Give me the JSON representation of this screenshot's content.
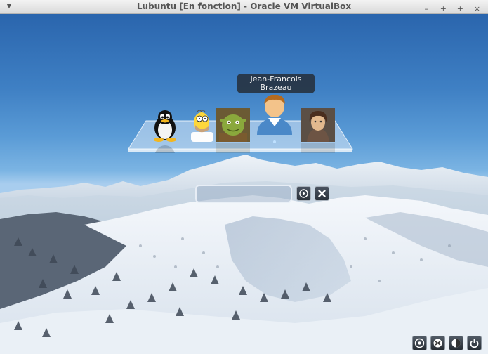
{
  "window": {
    "title": "Lubuntu [En fonction] - Oracle VM VirtualBox",
    "menu_icon": "chevron-down-icon",
    "controls": [
      {
        "name": "minimize-button",
        "glyph": "–"
      },
      {
        "name": "maximize-button",
        "glyph": "+"
      },
      {
        "name": "restore-button",
        "glyph": "+"
      },
      {
        "name": "close-button",
        "glyph": "×"
      }
    ]
  },
  "login": {
    "users": [
      {
        "id": "tux",
        "avatar": "tux-penguin-avatar"
      },
      {
        "id": "homer",
        "avatar": "homer-avatar"
      },
      {
        "id": "shrek",
        "avatar": "shrek-avatar"
      },
      {
        "id": "jean-francois",
        "avatar": "generic-user-avatar",
        "selected": true
      },
      {
        "id": "photo",
        "avatar": "photo-avatar"
      }
    ],
    "selected_user_name": "Jean-Francois Brazeau",
    "password_value": "",
    "submit_icon": "play-icon",
    "cancel_icon": "close-icon"
  },
  "bottom_buttons": [
    {
      "name": "accessibility-button",
      "icon": "accessibility-icon"
    },
    {
      "name": "keyboard-button",
      "icon": "keyboard-icon"
    },
    {
      "name": "session-button",
      "icon": "session-icon"
    },
    {
      "name": "power-button",
      "icon": "power-icon"
    }
  ]
}
